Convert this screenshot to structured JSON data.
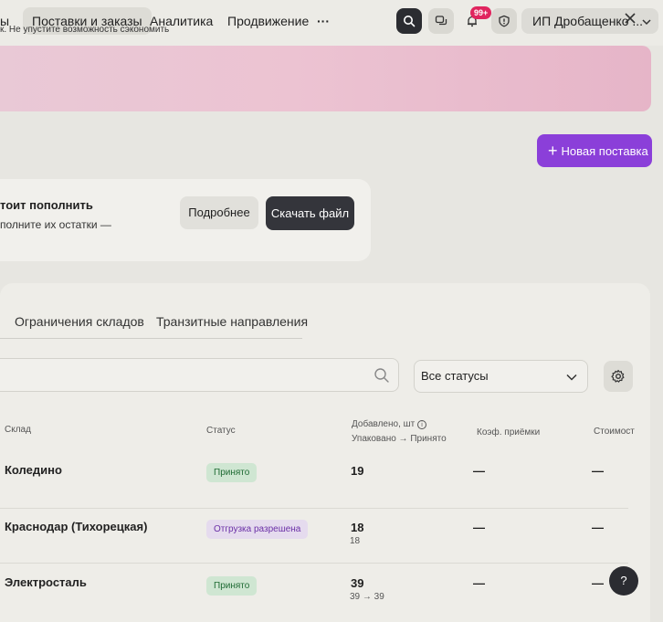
{
  "nav": {
    "items": [
      {
        "label": "ы"
      },
      {
        "label": "Поставки и заказы"
      },
      {
        "label": "Аналитика"
      },
      {
        "label": "Продвижение"
      },
      {
        "label": "···"
      }
    ],
    "notifications_badge": "99+",
    "account_name": "ИП Дробащенко ...",
    "colors": {
      "accent": "#8b3fd9",
      "badge": "#e0245e"
    }
  },
  "banner": {
    "text": "к. Не упустите возможность сэкономить"
  },
  "actions": {
    "new_supply_label": "Новая поставка"
  },
  "info_card": {
    "title": "тоит пополнить",
    "subtitle": "полните их остатки —",
    "more_label": "Подробнее",
    "download_label": "Скачать файл"
  },
  "tabs": [
    {
      "label": "Ограничения складов"
    },
    {
      "label": "Транзитные направления"
    }
  ],
  "filters": {
    "status_selected": "Все статусы"
  },
  "table": {
    "headers": {
      "warehouse": "Склад",
      "status": "Статус",
      "added_line1": "Добавлено, шт",
      "added_line2": "Упаковано → Принято",
      "coef": "Коэф. приёмки",
      "cost": "Стоимост"
    },
    "rows": [
      {
        "warehouse": "Коледино",
        "status": "Принято",
        "status_color": "#cfe6d2",
        "added": "19",
        "added_sub": "",
        "coef": "—",
        "cost": "—"
      },
      {
        "warehouse": "Краснодар (Тихорецкая)",
        "status": "Отгрузка разрешена",
        "status_color": "#e5dbee",
        "added": "18",
        "added_sub": "18",
        "coef": "—",
        "cost": "—"
      },
      {
        "warehouse": "Электросталь",
        "status": "Принято",
        "status_color": "#cfe6d2",
        "added": "39",
        "added_sub": "39 → 39",
        "coef": "—",
        "cost": "—"
      }
    ]
  },
  "help": {
    "label": "?"
  }
}
